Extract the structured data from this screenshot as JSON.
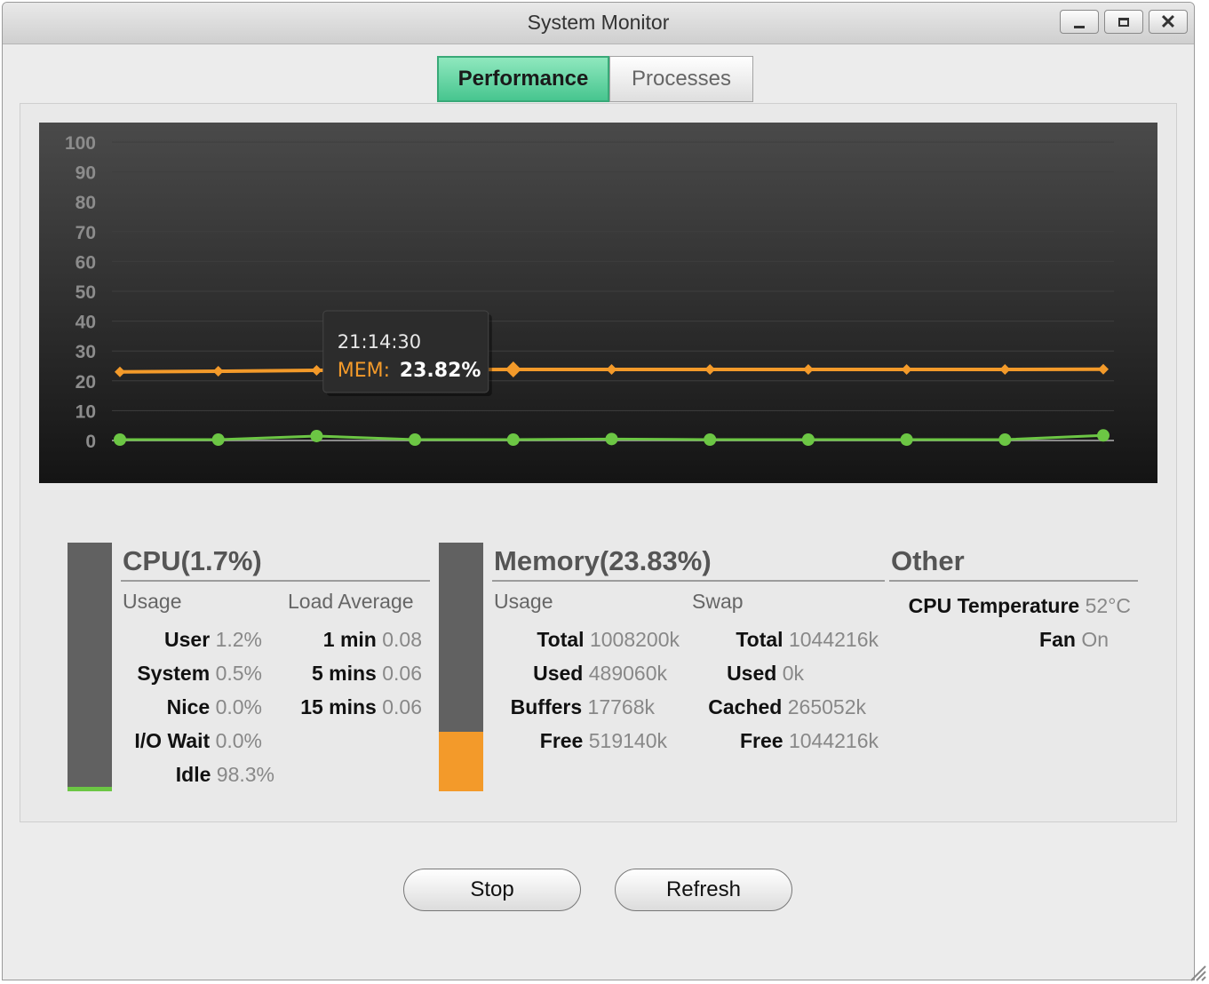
{
  "window": {
    "title": "System Monitor"
  },
  "tabs": [
    {
      "label": "Performance",
      "active": true
    },
    {
      "label": "Processes",
      "active": false
    }
  ],
  "chart_data": {
    "type": "line",
    "x": [
      1,
      2,
      3,
      4,
      5,
      6,
      7,
      8,
      9,
      10,
      11
    ],
    "ylim": [
      0,
      100
    ],
    "yticks": [
      0,
      10,
      20,
      30,
      40,
      50,
      60,
      70,
      80,
      90,
      100
    ],
    "grid": true,
    "series": [
      {
        "name": "MEM",
        "color": "#f39a2a",
        "values": [
          23.0,
          23.2,
          23.5,
          23.7,
          23.82,
          23.8,
          23.8,
          23.8,
          23.8,
          23.8,
          23.9
        ]
      },
      {
        "name": "CPU",
        "color": "#6cc644",
        "values": [
          0.3,
          0.3,
          1.5,
          0.3,
          0.3,
          0.5,
          0.3,
          0.3,
          0.3,
          0.3,
          1.7
        ]
      }
    ],
    "tooltip": {
      "time": "21:14:30",
      "label": "MEM:",
      "value": "23.82%",
      "index": 4
    }
  },
  "cpu": {
    "title": "CPU(1.7%)",
    "level_percent": 1.7,
    "bar_color": "#6cc644",
    "usage_header": "Usage",
    "load_header": "Load Average",
    "usage": [
      {
        "label": "User",
        "value": "1.2%"
      },
      {
        "label": "System",
        "value": "0.5%"
      },
      {
        "label": "Nice",
        "value": "0.0%"
      },
      {
        "label": "I/O Wait",
        "value": "0.0%"
      },
      {
        "label": "Idle",
        "value": "98.3%"
      }
    ],
    "load": [
      {
        "label": "1 min",
        "value": "0.08"
      },
      {
        "label": "5 mins",
        "value": "0.06"
      },
      {
        "label": "15 mins",
        "value": "0.06"
      }
    ]
  },
  "memory": {
    "title": "Memory(23.83%)",
    "level_percent": 23.83,
    "bar_color": "#f39a2a",
    "usage_header": "Usage",
    "swap_header": "Swap",
    "usage": [
      {
        "label": "Total",
        "value": "1008200k"
      },
      {
        "label": "Used",
        "value": "489060k"
      },
      {
        "label": "Buffers",
        "value": "17768k"
      },
      {
        "label": "Free",
        "value": "519140k"
      }
    ],
    "swap": [
      {
        "label": "Total",
        "value": "1044216k"
      },
      {
        "label": "Used",
        "value": "0k"
      },
      {
        "label": "Cached",
        "value": "265052k"
      },
      {
        "label": "Free",
        "value": "1044216k"
      }
    ]
  },
  "other": {
    "title": "Other",
    "items": [
      {
        "label": "CPU Temperature",
        "value": "52°C"
      },
      {
        "label": "Fan",
        "value": "On"
      }
    ]
  },
  "buttons": {
    "stop": "Stop",
    "refresh": "Refresh"
  }
}
